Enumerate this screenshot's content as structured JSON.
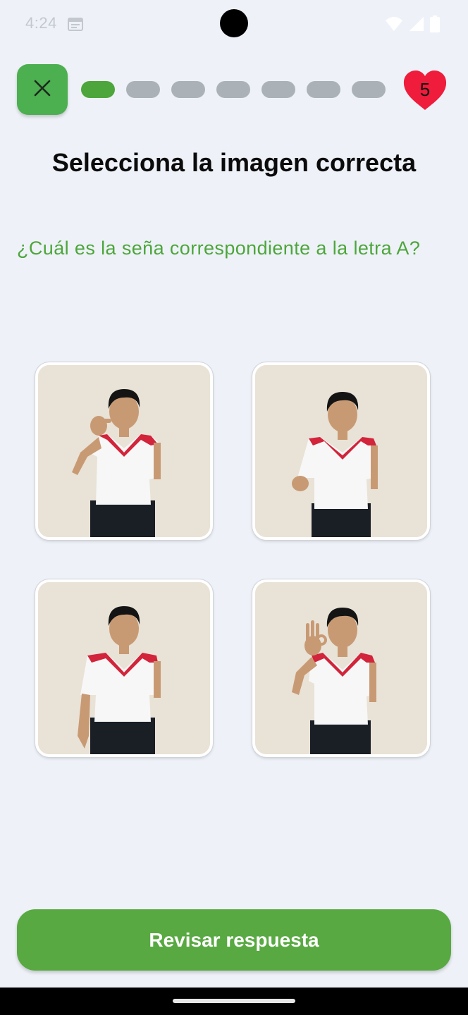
{
  "status_bar": {
    "time": "4:24",
    "icons": [
      "calendar-icon",
      "wifi-icon",
      "signal-icon",
      "battery-icon"
    ]
  },
  "header": {
    "close_icon": "close-icon",
    "progress": {
      "total_steps": 7,
      "current_step": 1
    },
    "lives": {
      "icon": "heart-icon",
      "count": "5",
      "color": "#ef1c3c"
    }
  },
  "exercise": {
    "title": "Selecciona la imagen correcta",
    "question": "¿Cuál es la seña correspondiente a la letra A?",
    "options": [
      {
        "image": "sign-photo-thumb-pointing"
      },
      {
        "image": "sign-photo-closed-hand-low"
      },
      {
        "image": "sign-photo-arms-down"
      },
      {
        "image": "sign-photo-ok-hand"
      }
    ]
  },
  "footer": {
    "check_button_label": "Revisar respuesta"
  },
  "colors": {
    "background": "#eef2f8",
    "accent_green": "#4da63b",
    "button_green": "#58a942",
    "inactive_segment": "#aab2b7",
    "heart_red": "#ef1c3c"
  }
}
